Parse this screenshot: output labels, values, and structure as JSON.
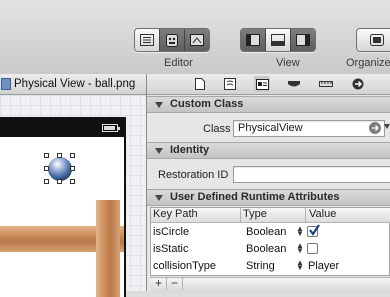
{
  "toolbar": {
    "editor_label": "Editor",
    "view_label": "View",
    "organizer_label": "Organize"
  },
  "editor": {
    "tab_title": "Physical View - ball.png"
  },
  "inspector": {
    "custom_class": {
      "title": "Custom Class",
      "class_label": "Class",
      "class_value": "PhysicalView"
    },
    "identity": {
      "title": "Identity",
      "restoration_id_label": "Restoration ID",
      "restoration_id_value": ""
    },
    "runtime_attributes": {
      "title": "User Defined Runtime Attributes",
      "columns": [
        "Key Path",
        "Type",
        "Value"
      ],
      "rows": [
        {
          "key": "isCircle",
          "type": "Boolean",
          "value": "",
          "checked": true
        },
        {
          "key": "isStatic",
          "type": "Boolean",
          "value": "",
          "checked": false
        },
        {
          "key": "collisionType",
          "type": "String",
          "value": "Player"
        }
      ],
      "add_label": "+",
      "remove_label": "−"
    }
  },
  "icons": {
    "editor_buttons": [
      "standard-editor-icon",
      "assistant-editor-icon",
      "version-editor-icon"
    ],
    "view_buttons": [
      "navigator-toggle-icon",
      "debug-area-toggle-icon",
      "utilities-toggle-icon"
    ],
    "inspector_tabs": [
      "file-inspector-icon",
      "quick-help-icon",
      "identity-inspector-icon",
      "attributes-inspector-icon",
      "size-inspector-icon",
      "connections-inspector-icon"
    ]
  },
  "colors": {
    "checkbox_check": "#1b3f8a",
    "ball_color": "#4b6ea8",
    "wood_color": "#c98a57"
  }
}
